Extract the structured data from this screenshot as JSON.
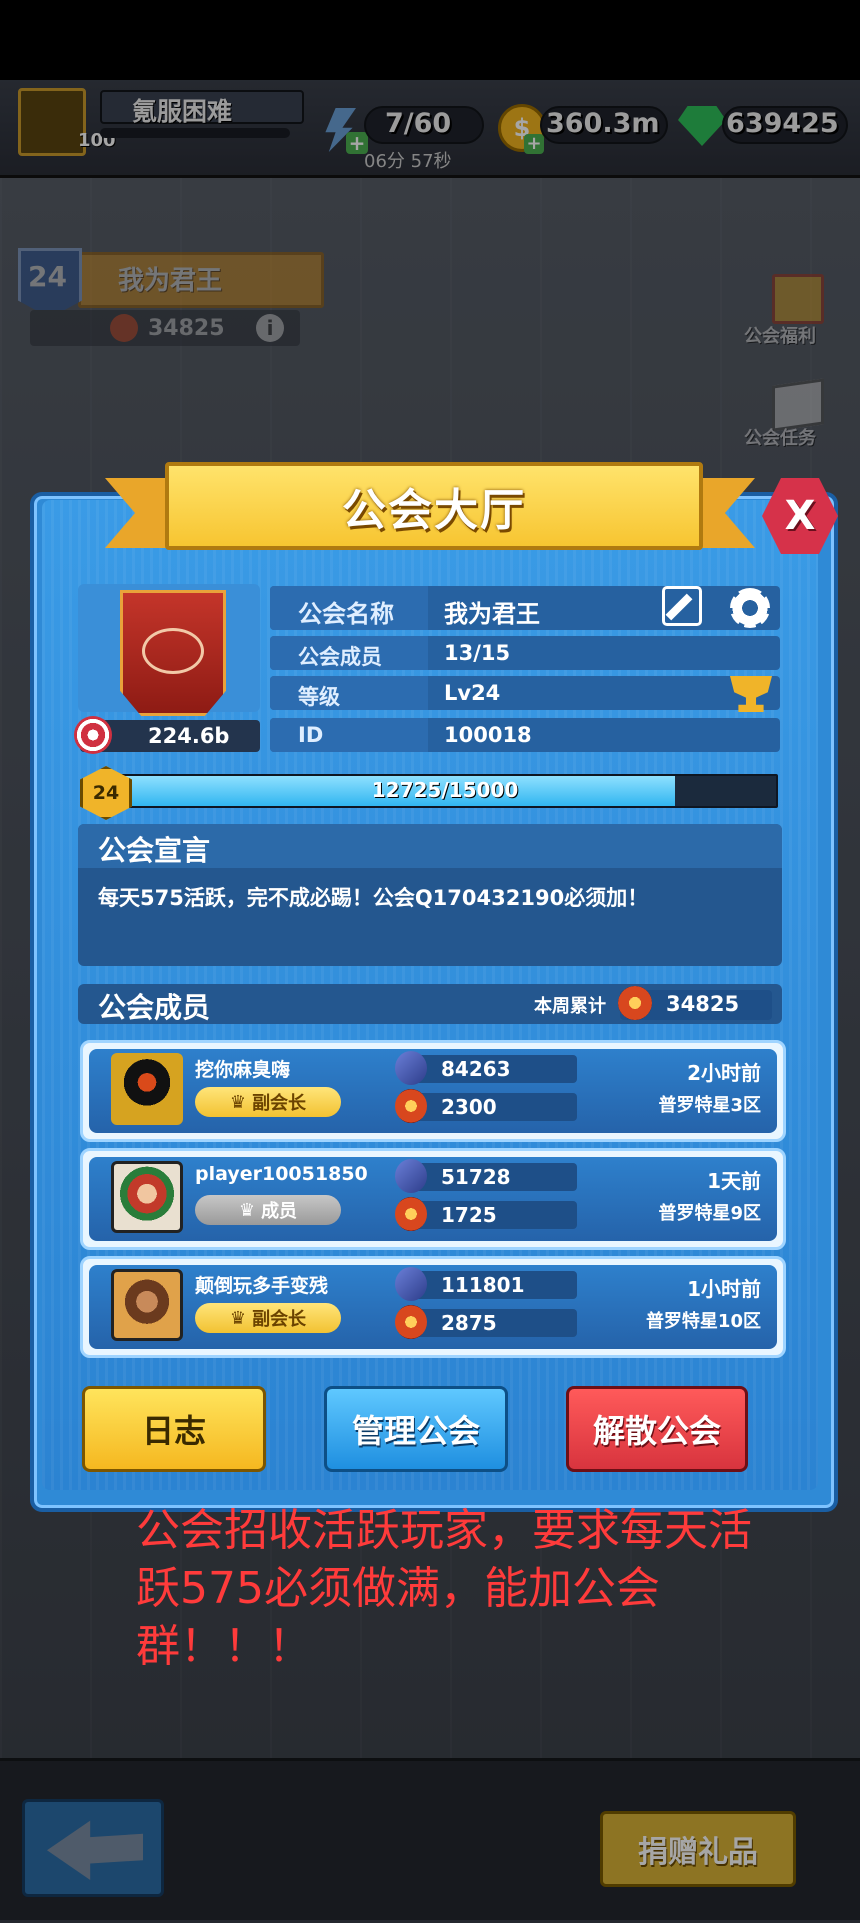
{
  "top": {
    "player_name": "氪服困难",
    "player_level": "100",
    "energy": "7/60",
    "energy_timer": "06分 57秒",
    "gold": "360.3m",
    "gems": "639425"
  },
  "guild_card": {
    "level": "24",
    "name": "我为君王",
    "points": "34825"
  },
  "right_menu": {
    "welfare_label": "公会福利",
    "tasks_label": "公会任务"
  },
  "bottom": {
    "donate_label": "捐赠礼品"
  },
  "modal": {
    "title": "公会大厅",
    "close_label": "X",
    "power": "224.6b",
    "info": {
      "name_label": "公会名称",
      "name_value": "我为君王",
      "members_label": "公会成员",
      "members_value": "13/15",
      "level_label": "等级",
      "level_value": "Lv24",
      "id_label": "ID",
      "id_value": "100018"
    },
    "exp": {
      "level": "24",
      "text": "12725/15000",
      "fraction": 0.848
    },
    "declaration": {
      "title": "公会宣言",
      "text": "每天575活跃，完不成必踢！公会Q170432190必须加！"
    },
    "members_section": {
      "title": "公会成员",
      "weekly_label": "本周累计",
      "weekly_value": "34825"
    },
    "members": [
      {
        "name": "挖你麻臭嗨",
        "role": "副会长",
        "power": "84263",
        "points": "2300",
        "time": "2小时前",
        "server": "普罗特星3区"
      },
      {
        "name": "player10051850",
        "role": "成员",
        "power": "51728",
        "points": "1725",
        "time": "1天前",
        "server": "普罗特星9区"
      },
      {
        "name": "颠倒玩多手变残",
        "role": "副会长",
        "power": "111801",
        "points": "2875",
        "time": "1小时前",
        "server": "普罗特星10区"
      }
    ],
    "buttons": {
      "log": "日志",
      "manage": "管理公会",
      "disband": "解散公会"
    }
  },
  "overlay_text": "公会招收活跃玩家，要求每天活跃575必须做满，能加公会群！！！",
  "colors": {
    "accent_blue": "#2f8ad6",
    "gold": "#f7c531",
    "red_button": "#d8343e",
    "overlay_text": "#ff3b3b"
  }
}
